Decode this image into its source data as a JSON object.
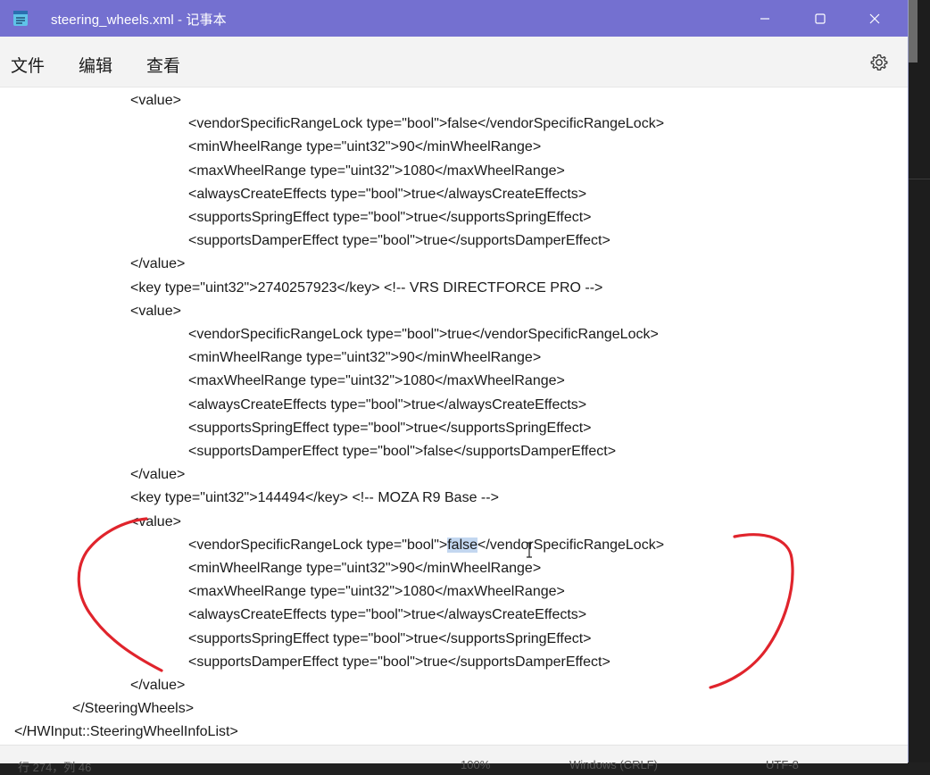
{
  "window": {
    "title": "steering_wheels.xml - 记事本",
    "accent_color": "#7470d0",
    "controls": {
      "minimize": "minimize-icon",
      "maximize": "maximize-icon",
      "close": "close-icon"
    }
  },
  "menu": {
    "items": [
      "文件",
      "编辑",
      "查看"
    ],
    "settings_icon": "gear-icon"
  },
  "editor": {
    "lines": [
      {
        "indent": 1,
        "text": "<value>"
      },
      {
        "indent": 2,
        "text": "<vendorSpecificRangeLock type=\"bool\">false</vendorSpecificRangeLock>"
      },
      {
        "indent": 2,
        "text": "<minWheelRange type=\"uint32\">90</minWheelRange>"
      },
      {
        "indent": 2,
        "text": "<maxWheelRange type=\"uint32\">1080</maxWheelRange>"
      },
      {
        "indent": 2,
        "text": "<alwaysCreateEffects type=\"bool\">true</alwaysCreateEffects>"
      },
      {
        "indent": 2,
        "text": "<supportsSpringEffect type=\"bool\">true</supportsSpringEffect>"
      },
      {
        "indent": 2,
        "text": "<supportsDamperEffect type=\"bool\">true</supportsDamperEffect>"
      },
      {
        "indent": 1,
        "text": "</value>"
      },
      {
        "indent": 1,
        "text": "<key type=\"uint32\">2740257923</key> <!-- VRS DIRECTFORCE PRO -->"
      },
      {
        "indent": 1,
        "text": "<value>"
      },
      {
        "indent": 2,
        "text": "<vendorSpecificRangeLock type=\"bool\">true</vendorSpecificRangeLock>"
      },
      {
        "indent": 2,
        "text": "<minWheelRange type=\"uint32\">90</minWheelRange>"
      },
      {
        "indent": 2,
        "text": "<maxWheelRange type=\"uint32\">1080</maxWheelRange>"
      },
      {
        "indent": 2,
        "text": "<alwaysCreateEffects type=\"bool\">true</alwaysCreateEffects>"
      },
      {
        "indent": 2,
        "text": "<supportsSpringEffect type=\"bool\">true</supportsSpringEffect>"
      },
      {
        "indent": 2,
        "text": "<supportsDamperEffect type=\"bool\">false</supportsDamperEffect>"
      },
      {
        "indent": 1,
        "text": "</value>"
      },
      {
        "indent": 1,
        "text": "<key type=\"uint32\">144494</key> <!-- MOZA R9 Base -->"
      },
      {
        "indent": 1,
        "text": "<value>"
      },
      {
        "indent": 2,
        "text": "<vendorSpecificRangeLock type=\"bool\">false</vendorSpecificRangeLock>",
        "selection": "false"
      },
      {
        "indent": 2,
        "text": "<minWheelRange type=\"uint32\">90</minWheelRange>"
      },
      {
        "indent": 2,
        "text": "<maxWheelRange type=\"uint32\">1080</maxWheelRange>"
      },
      {
        "indent": 2,
        "text": "<alwaysCreateEffects type=\"bool\">true</alwaysCreateEffects>"
      },
      {
        "indent": 2,
        "text": "<supportsSpringEffect type=\"bool\">true</supportsSpringEffect>"
      },
      {
        "indent": 2,
        "text": "<supportsDamperEffect type=\"bool\">true</supportsDamperEffect>"
      },
      {
        "indent": 1,
        "text": "</value>"
      },
      {
        "indent": 0,
        "text": "</SteeringWheels>"
      },
      {
        "indent": -1,
        "text": "</HWInput::SteeringWheelInfoList>"
      }
    ],
    "selection_color": "#c3d7f0"
  },
  "status": {
    "position": "行 274，列 46",
    "zoom": "100%",
    "line_ending": "Windows (CRLF)",
    "encoding": "UTF-8"
  },
  "annotation": {
    "color": "#e0242c"
  }
}
